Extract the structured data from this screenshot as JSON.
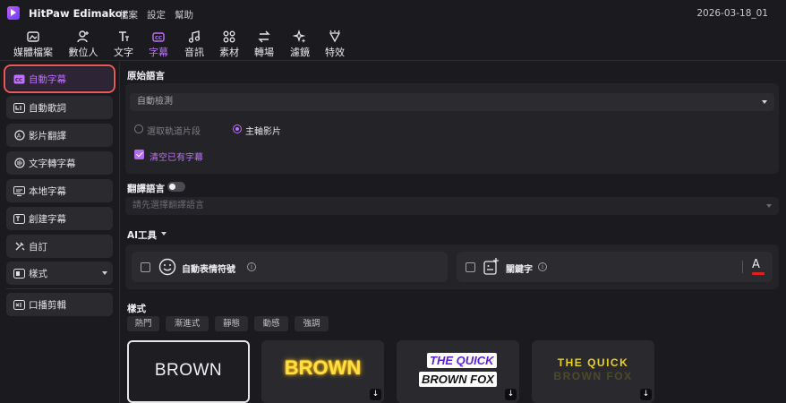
{
  "titlebar": {
    "app_name": "HitPaw Edimakor",
    "menu": [
      "檔案",
      "設定",
      "幫助"
    ],
    "project_name": "2026-03-18_01"
  },
  "toolbar": [
    {
      "label": "媒體檔案",
      "icon": "media-icon"
    },
    {
      "label": "數位人",
      "icon": "avatar-add-icon"
    },
    {
      "label": "文字",
      "icon": "text-icon"
    },
    {
      "label": "字幕",
      "icon": "subtitle-icon",
      "active": true
    },
    {
      "label": "音訊",
      "icon": "audio-icon"
    },
    {
      "label": "素材",
      "icon": "assets-icon"
    },
    {
      "label": "轉場",
      "icon": "transition-icon"
    },
    {
      "label": "濾鏡",
      "icon": "filter-icon"
    },
    {
      "label": "特效",
      "icon": "effects-icon"
    }
  ],
  "sidebar": [
    {
      "label": "自動字幕",
      "icon": "cc-icon",
      "active": true
    },
    {
      "label": "自動歌詞",
      "icon": "lyrics-icon"
    },
    {
      "label": "影片翻譯",
      "icon": "translate-icon"
    },
    {
      "label": "文字轉字幕",
      "icon": "text-to-subtitle-icon"
    },
    {
      "label": "本地字幕",
      "icon": "local-subtitle-icon"
    },
    {
      "label": "創建字幕",
      "icon": "create-subtitle-icon"
    },
    {
      "label": "自訂",
      "icon": "custom-icon"
    },
    {
      "label": "樣式",
      "icon": "style-icon"
    },
    {
      "label": "口播剪輯",
      "icon": "speech-edit-icon"
    }
  ],
  "source_language": {
    "title": "原始語言",
    "selected": "自動檢測",
    "radio_segment": "選取軌道片段",
    "radio_main": "主軸影片",
    "clear_existing": "清空已有字幕"
  },
  "translation": {
    "title": "翻譯語言",
    "placeholder": "請先選擇翻譯語言",
    "enabled": false
  },
  "ai_tools": {
    "title": "AI工具",
    "emoji_label": "自動表情符號",
    "keyword_label": "關鍵字",
    "font_color_glyph": "A"
  },
  "styles": {
    "title": "樣式",
    "tabs": [
      "熱門",
      "漸進式",
      "靜態",
      "動感",
      "強調"
    ],
    "presets": [
      {
        "line1": "BROWN"
      },
      {
        "line1": "BROWN"
      },
      {
        "line1": "THE QUICK",
        "line2": "BROWN FOX"
      },
      {
        "line1": "THE QUICK",
        "line2": "BROWN FOX"
      }
    ]
  },
  "colors": {
    "accent": "#c070ff",
    "highlight_border": "#e85a5a",
    "panel": "#232328"
  }
}
